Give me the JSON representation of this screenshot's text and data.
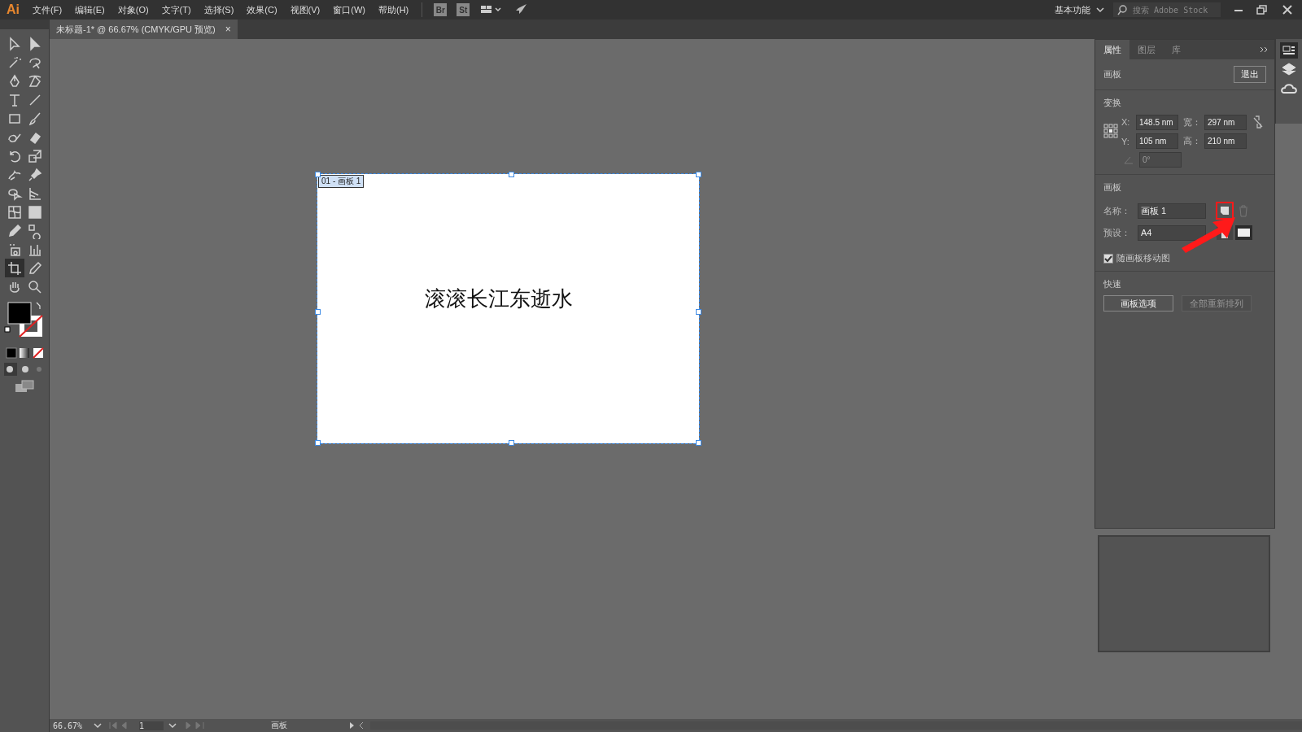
{
  "app": {
    "logo": "Ai"
  },
  "menu": [
    "文件(F)",
    "编辑(E)",
    "对象(O)",
    "文字(T)",
    "选择(S)",
    "效果(C)",
    "视图(V)",
    "窗口(W)",
    "帮助(H)"
  ],
  "bridge_buttons": [
    "Br",
    "St"
  ],
  "workspace": "基本功能",
  "search": {
    "placeholder": "搜索 Adobe Stock"
  },
  "document_tab": {
    "title": "未标题-1* @ 66.67% (CMYK/GPU 预览)",
    "close": "×"
  },
  "tools": [
    {
      "kind": "select",
      "selected": false
    },
    {
      "kind": "direct",
      "selected": false
    },
    {
      "kind": "wand",
      "selected": false
    },
    {
      "kind": "lasso",
      "selected": false
    },
    {
      "kind": "pen",
      "selected": false
    },
    {
      "kind": "curvature",
      "selected": false
    },
    {
      "kind": "type",
      "selected": false
    },
    {
      "kind": "line",
      "selected": false
    },
    {
      "kind": "rect",
      "selected": false
    },
    {
      "kind": "brush",
      "selected": false
    },
    {
      "kind": "shaper",
      "selected": false
    },
    {
      "kind": "eraser",
      "selected": false
    },
    {
      "kind": "rotate",
      "selected": false
    },
    {
      "kind": "scale",
      "selected": false
    },
    {
      "kind": "warp",
      "selected": false
    },
    {
      "kind": "pin",
      "selected": false
    },
    {
      "kind": "shapebuilder",
      "selected": false
    },
    {
      "kind": "perspective",
      "selected": false
    },
    {
      "kind": "mesh",
      "selected": false
    },
    {
      "kind": "gradient",
      "selected": false
    },
    {
      "kind": "eyedropper",
      "selected": false
    },
    {
      "kind": "blend",
      "selected": false
    },
    {
      "kind": "symbol",
      "selected": false
    },
    {
      "kind": "graph",
      "selected": false
    },
    {
      "kind": "artboard",
      "selected": true
    },
    {
      "kind": "slice",
      "selected": false
    },
    {
      "kind": "hand",
      "selected": false
    },
    {
      "kind": "zoom",
      "selected": false
    }
  ],
  "artboard": {
    "label": "01 - 画板 1",
    "text": "滚滚长江东逝水"
  },
  "panel": {
    "tabs": [
      {
        "label": "属性",
        "selected": true
      },
      {
        "label": "图层",
        "selected": false
      },
      {
        "label": "库",
        "selected": false
      }
    ],
    "mode": {
      "heading": "画板",
      "button": "退出"
    },
    "transform": {
      "heading": "变换",
      "x_label": "X:",
      "x": "148.5 nm",
      "y_label": "Y:",
      "y": "105 nm",
      "w_label": "宽：",
      "w": "297 nm",
      "h_label": "高：",
      "h": "210 nm",
      "angle": {
        "value": "0°",
        "disabled": true
      }
    },
    "artboard": {
      "heading": "画板",
      "name_label": "名称：",
      "name": "画板 1",
      "preset_label": "预设：",
      "preset": "A4"
    },
    "move_with_artboard": {
      "label": "随画板移动图",
      "checked": true
    },
    "quick_actions": {
      "heading": "快速",
      "buttons": [
        {
          "label": "画板选项",
          "disabled": false
        },
        {
          "label": "全部重新排列",
          "disabled": true
        }
      ]
    }
  },
  "status_bar": {
    "zoom": "66.67%",
    "page": "1",
    "tool": "画板"
  }
}
